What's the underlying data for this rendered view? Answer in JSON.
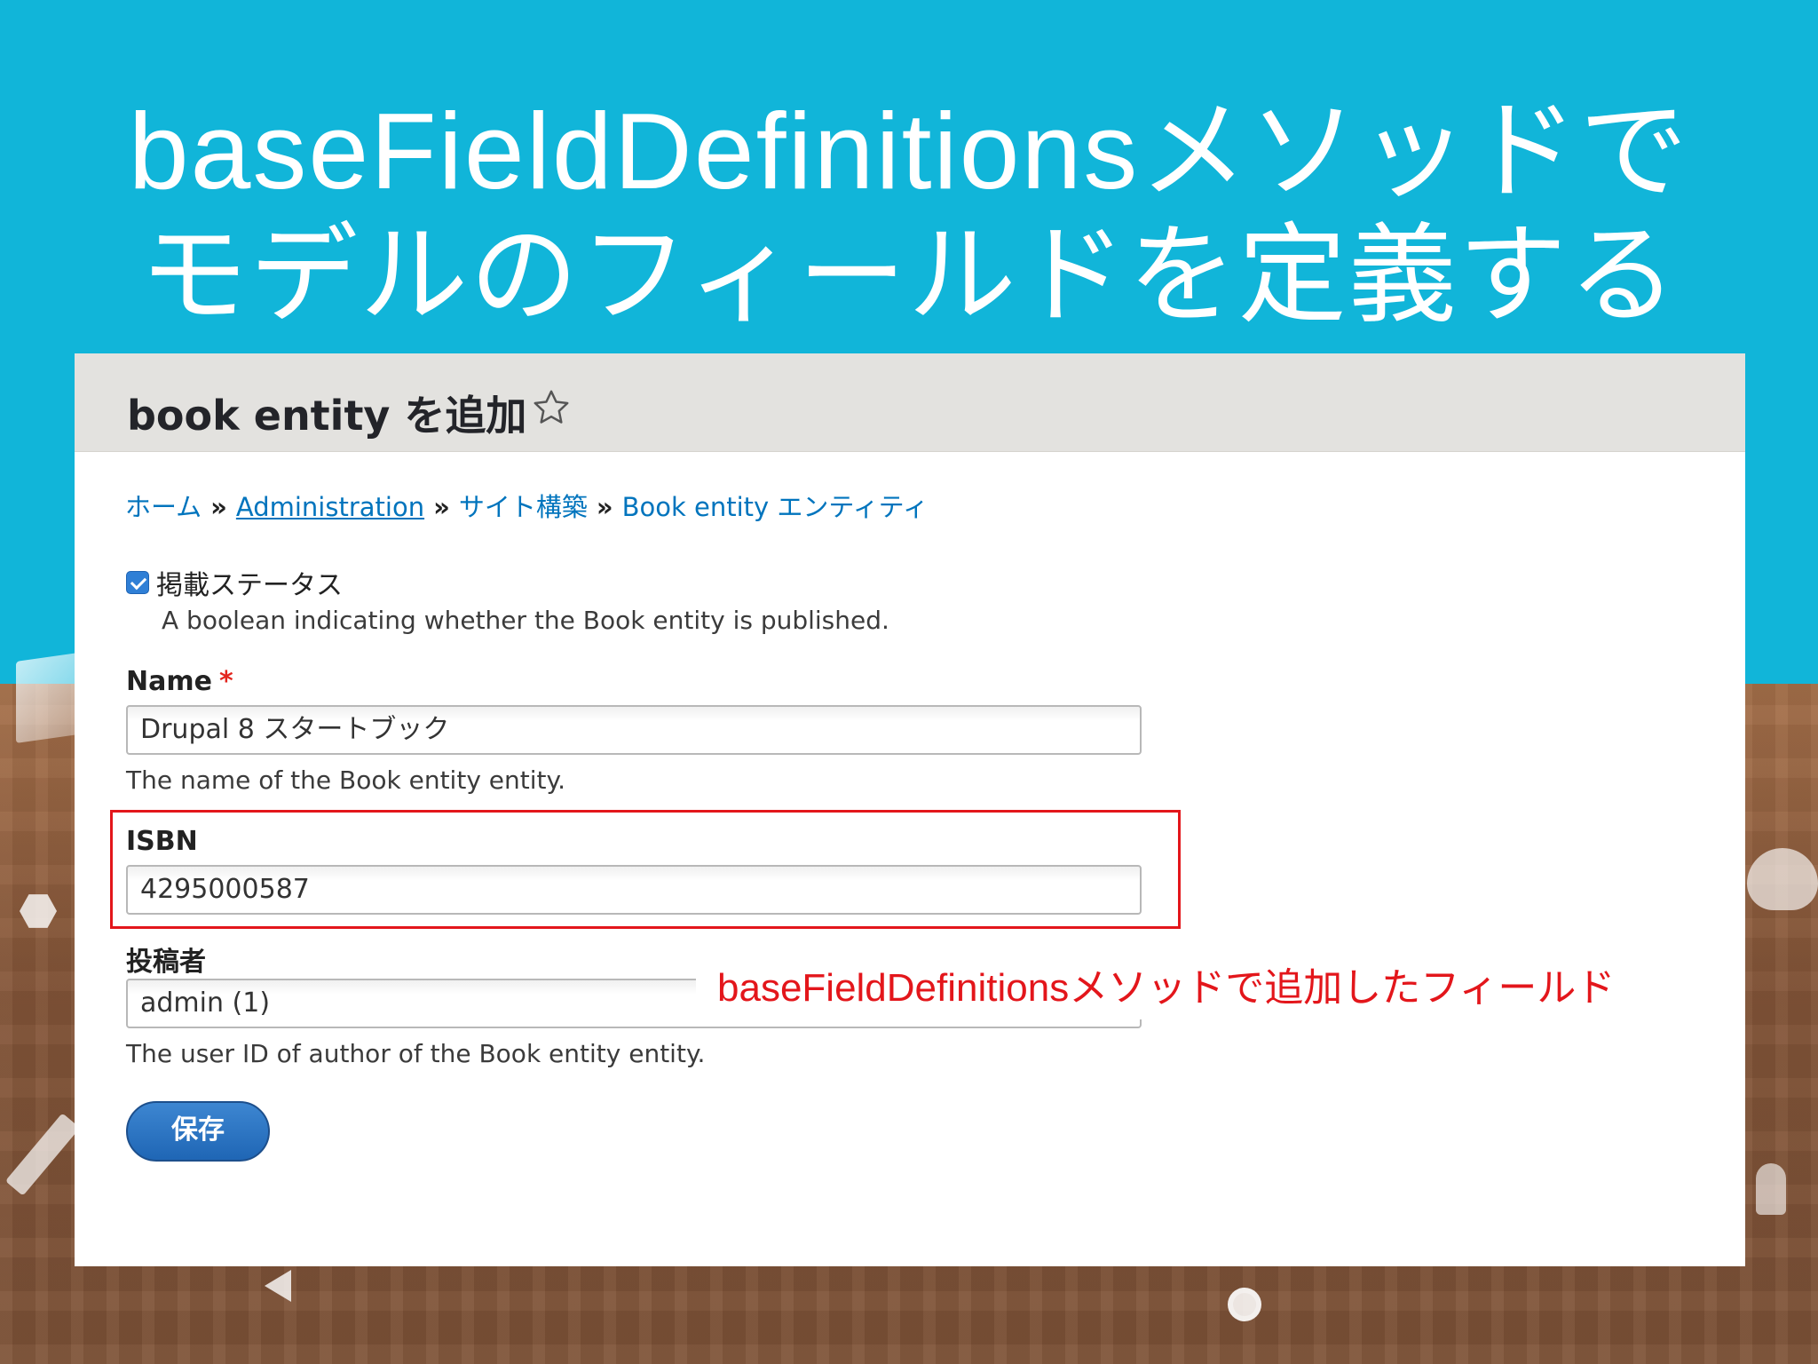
{
  "slide": {
    "title_line1": "baseFieldDefinitionsメソッドで",
    "title_line2": "モデルのフィールドを定義する",
    "annotation": "baseFieldDefinitionsメソッドで追加したフィールド",
    "colors": {
      "background_top": "#11b5d9",
      "title_text": "#ffffff",
      "annotation": "#e3161b",
      "highlight_border": "#e3161b"
    }
  },
  "page": {
    "title": "book entity を追加",
    "breadcrumb": [
      {
        "label": "ホーム"
      },
      {
        "label": "Administration"
      },
      {
        "label": "サイト構築"
      },
      {
        "label": "Book entity エンティティ"
      }
    ],
    "breadcrumb_separator": "»"
  },
  "form": {
    "status": {
      "label": "掲載ステータス",
      "checked": true,
      "description": "A boolean indicating whether the Book entity is published."
    },
    "name": {
      "label": "Name",
      "required_mark": "*",
      "value": "Drupal 8 スタートブック",
      "description": "The name of the Book entity entity."
    },
    "isbn": {
      "label": "ISBN",
      "value": "4295000587"
    },
    "author": {
      "label": "投稿者",
      "value": "admin (1)",
      "description": "The user ID of author of the Book entity entity."
    },
    "save_label": "保存"
  },
  "icons": {
    "star": "star-outline-icon",
    "checkbox": "checkbox-checked-icon"
  }
}
